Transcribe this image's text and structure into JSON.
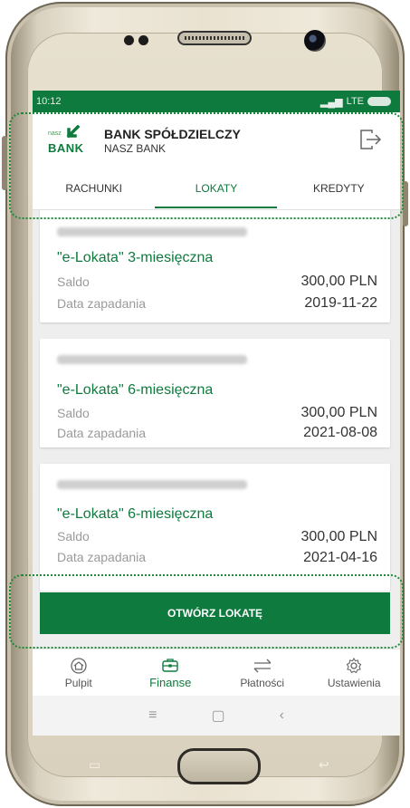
{
  "status": {
    "time": "10:12",
    "network": "LTE"
  },
  "header": {
    "logo_small": "nasz",
    "logo_word": "BANK",
    "bank_name": "BANK SPÓŁDZIELCZY",
    "bank_subname": "NASZ BANK",
    "logout_icon": "logout-icon"
  },
  "tabs": [
    {
      "label": "RACHUNKI",
      "active": false
    },
    {
      "label": "LOKATY",
      "active": true
    },
    {
      "label": "KREDYTY",
      "active": false
    }
  ],
  "deposits": [
    {
      "account": "72 8787 0000 0000 0044 4000 0350",
      "title": "\"e-Lokata\" 3-miesięczna",
      "balance_label": "Saldo",
      "balance": "300,00 PLN",
      "maturity_label": "Data zapadania",
      "maturity": "2019-11-22"
    },
    {
      "account": "85 8787 0000 0000 0044 4000 0310",
      "title": "\"e-Lokata\" 6-miesięczna",
      "balance_label": "Saldo",
      "balance": "300,00 PLN",
      "maturity_label": "Data zapadania",
      "maturity": "2021-08-08"
    },
    {
      "account": "35 8787 0000 0000 0044 4000 0240",
      "title": "\"e-Lokata\" 6-miesięczna",
      "balance_label": "Saldo",
      "balance": "300,00 PLN",
      "maturity_label": "Data zapadania",
      "maturity": "2021-04-16"
    }
  ],
  "cta": {
    "label": "OTWÓRZ LOKATĘ"
  },
  "bottom_nav": [
    {
      "label": "Pulpit",
      "icon": "home-icon",
      "active": false
    },
    {
      "label": "Finanse",
      "icon": "briefcase-icon",
      "active": true
    },
    {
      "label": "Płatności",
      "icon": "transfer-arrows-icon",
      "active": false
    },
    {
      "label": "Ustawienia",
      "icon": "gear-icon",
      "active": false
    }
  ],
  "colors": {
    "brand_green": "#0f7a3d",
    "highlight_dotted": "#1d8a3a"
  }
}
